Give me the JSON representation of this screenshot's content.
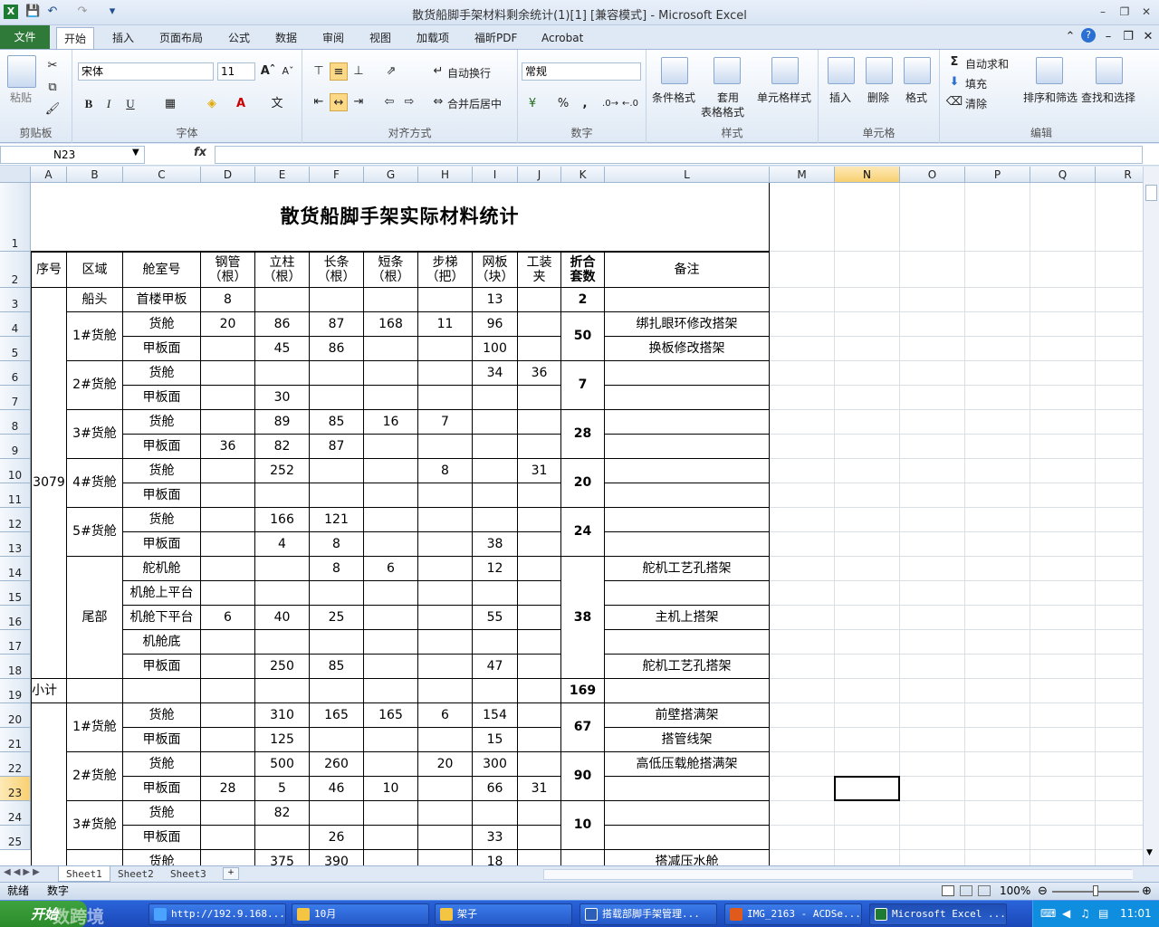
{
  "window": {
    "title": "散货船脚手架材料剩余统计(1)[1]  [兼容模式] - Microsoft Excel",
    "icons": [
      "excel-icon",
      "save-icon",
      "undo-icon",
      "redo-icon",
      "customize-icon"
    ],
    "controls": [
      "minimize",
      "restore",
      "close"
    ]
  },
  "tabs": [
    "文件",
    "开始",
    "插入",
    "页面布局",
    "公式",
    "数据",
    "审阅",
    "视图",
    "加载项",
    "福昕PDF",
    "Acrobat"
  ],
  "ribbon": {
    "clipboard": {
      "paste": "粘贴",
      "label": "剪贴板"
    },
    "font": {
      "name": "宋体",
      "size": "11",
      "label": "字体",
      "bold": "B",
      "italic": "I",
      "underline": "U"
    },
    "align": {
      "wrap": "自动换行",
      "merge": "合并后居中",
      "label": "对齐方式"
    },
    "number": {
      "format": "常规",
      "label": "数字",
      "percent": "%",
      "comma": ","
    },
    "styles": {
      "cond": "条件格式",
      "table1": "套用",
      "table2": "表格格式",
      "cell": "单元格样式",
      "label": "样式"
    },
    "cells": {
      "insert": "插入",
      "delete": "删除",
      "format": "格式",
      "label": "单元格"
    },
    "edit": {
      "autosum": "自动求和",
      "fill": "填充",
      "clear": "清除",
      "sort": "排序和筛选",
      "find": "查找和选择",
      "label": "编辑"
    }
  },
  "formula_bar": {
    "name": "N23",
    "fx": "fx",
    "value": ""
  },
  "columns": [
    "A",
    "B",
    "C",
    "D",
    "E",
    "F",
    "G",
    "H",
    "I",
    "J",
    "K",
    "L",
    "M",
    "N",
    "O",
    "P",
    "Q",
    "R"
  ],
  "rows": [
    "1",
    "2",
    "3",
    "4",
    "5",
    "6",
    "7",
    "8",
    "9",
    "10",
    "11",
    "12",
    "13",
    "14",
    "15",
    "16",
    "17",
    "18",
    "19",
    "20",
    "21",
    "22",
    "23",
    "24",
    "25"
  ],
  "sheet": {
    "title": "散货船脚手架实际材料统计",
    "headers": {
      "seq": "序号",
      "area": "区域",
      "cabin": "舱室号",
      "pipe": "钢管\n（根）",
      "post": "立柱\n（根）",
      "long": "长条\n（根）",
      "short": "短条\n（根）",
      "ladder": "步梯\n（把）",
      "net": "网板\n（块）",
      "fix": "工装\n夹",
      "sets": "折合\n套数",
      "note": "备注"
    },
    "ship": "3079",
    "areas": {
      "bow": "船头",
      "h1": "1#货舱",
      "h2": "2#货舱",
      "h3": "3#货舱",
      "h4": "4#货舱",
      "h5": "5#货舱",
      "stern": "尾部",
      "b1": "1#货舱",
      "b2": "2#货舱",
      "b3": "3#货舱"
    },
    "sets": {
      "bow": "2",
      "h1": "50",
      "h2": "7",
      "h3": "28",
      "h4": "20",
      "h5": "24",
      "stern": "38",
      "b1": "67",
      "b2": "90",
      "b3": "10"
    },
    "subtotal": {
      "label": "小计",
      "value": "169"
    },
    "r3": [
      "首楼甲板",
      "8",
      "",
      "",
      "",
      "",
      "13",
      ""
    ],
    "r4": [
      "货舱",
      "20",
      "86",
      "87",
      "168",
      "11",
      "96",
      ""
    ],
    "r5": [
      "甲板面",
      "",
      "45",
      "86",
      "",
      "",
      "100",
      ""
    ],
    "r6": [
      "货舱",
      "",
      "",
      "",
      "",
      "",
      "34",
      "36"
    ],
    "r7": [
      "甲板面",
      "",
      "30",
      "",
      "",
      "",
      "",
      ""
    ],
    "r8": [
      "货舱",
      "",
      "89",
      "85",
      "16",
      "7",
      "",
      ""
    ],
    "r9": [
      "甲板面",
      "36",
      "82",
      "87",
      "",
      "",
      "",
      ""
    ],
    "r10": [
      "货舱",
      "",
      "252",
      "",
      "",
      "8",
      "",
      "31"
    ],
    "r11": [
      "甲板面",
      "",
      "",
      "",
      "",
      "",
      "",
      ""
    ],
    "r12": [
      "货舱",
      "",
      "166",
      "121",
      "",
      "",
      "",
      ""
    ],
    "r13": [
      "甲板面",
      "",
      "4",
      "8",
      "",
      "",
      "38",
      ""
    ],
    "r14": [
      "舵机舱",
      "",
      "",
      "8",
      "6",
      "",
      "12",
      ""
    ],
    "r15": [
      "机舱上平台",
      "",
      "",
      "",
      "",
      "",
      "",
      ""
    ],
    "r16": [
      "机舱下平台",
      "6",
      "40",
      "25",
      "",
      "",
      "55",
      ""
    ],
    "r17": [
      "机舱底",
      "",
      "",
      "",
      "",
      "",
      "",
      ""
    ],
    "r18": [
      "甲板面",
      "",
      "250",
      "85",
      "",
      "",
      "47",
      ""
    ],
    "r20": [
      "货舱",
      "",
      "310",
      "165",
      "165",
      "6",
      "154",
      ""
    ],
    "r21": [
      "甲板面",
      "",
      "125",
      "",
      "",
      "",
      "15",
      ""
    ],
    "r22": [
      "货舱",
      "",
      "500",
      "260",
      "",
      "20",
      "300",
      ""
    ],
    "r23": [
      "甲板面",
      "28",
      "5",
      "46",
      "10",
      "",
      "66",
      "31"
    ],
    "r24": [
      "货舱",
      "",
      "82",
      "",
      "",
      "",
      "",
      ""
    ],
    "r25": [
      "甲板面",
      "",
      "",
      "26",
      "",
      "",
      "33",
      ""
    ],
    "r26": [
      "货舱",
      "",
      "375",
      "390",
      "",
      "",
      "18",
      ""
    ],
    "notes": {
      "r4": "绑扎眼环修改搭架",
      "r5": "换板修改搭架",
      "r14": "舵机工艺孔搭架",
      "r16": "主机上搭架",
      "r18": "舵机工艺孔搭架",
      "r20": "前壁搭满架",
      "r21": "搭管线架",
      "r22": "高低压载舱搭满架",
      "r26": "搭减压水舱"
    }
  },
  "sheet_tabs": [
    "Sheet1",
    "Sheet2",
    "Sheet3"
  ],
  "status": {
    "ready": "就绪",
    "mode": "数字",
    "zoom": "100%"
  },
  "taskbar": {
    "start": "开始",
    "items": [
      "http://192.9.168....",
      "10月",
      "架子",
      "搭载部脚手架管理...",
      "IMG_2163 - ACDSe...",
      "Microsoft Excel ..."
    ],
    "time": "11:01"
  },
  "watermark": "数跨境"
}
